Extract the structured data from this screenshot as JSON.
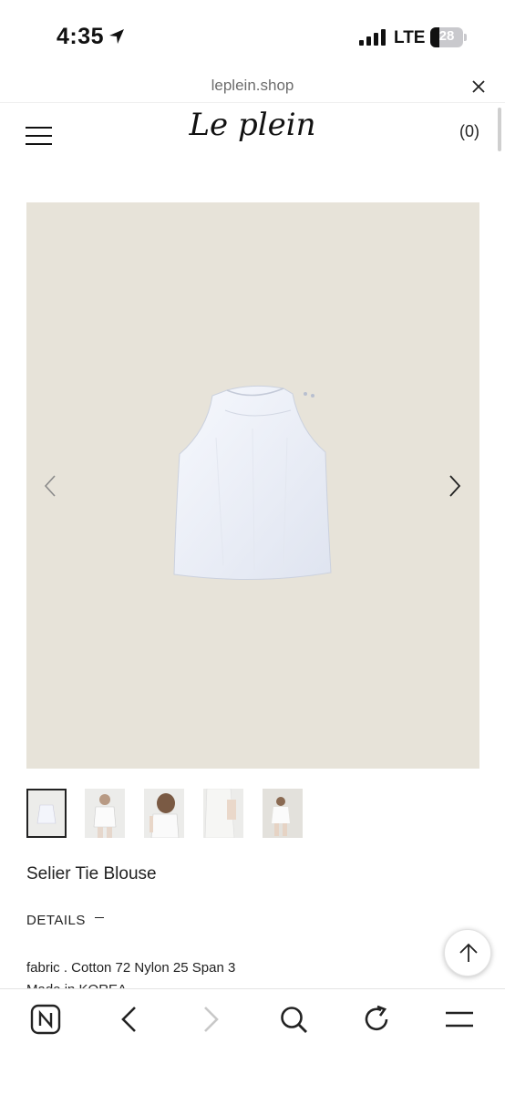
{
  "status_bar": {
    "time": "4:35",
    "carrier": "LTE",
    "battery_level": "28",
    "battery_fraction": 0.28
  },
  "browser": {
    "url": "leplein.shop"
  },
  "site": {
    "logo_text": "Le plein",
    "cart_count": "(0)"
  },
  "product": {
    "title": "Selier Tie Blouse",
    "details_label": "DETAILS",
    "fabric": "fabric . Cotton 72 Nylon 25 Span 3",
    "origin": "Made in KOREA",
    "thumbnail_count": 5,
    "active_thumbnail": 1
  },
  "icons": {
    "status": [
      "location-arrow-icon",
      "signal-icon",
      "battery-icon"
    ],
    "header": [
      "menu-icon",
      "close-icon"
    ],
    "gallery": [
      "chevron-left-icon",
      "chevron-right-icon"
    ],
    "page": [
      "arrow-up-icon"
    ],
    "toolbar": [
      "naver-home-icon",
      "back-icon",
      "forward-icon",
      "search-icon",
      "reload-icon",
      "menu-icon"
    ]
  },
  "colors": {
    "image_background": "#e7e3d9",
    "text": "#222222",
    "disabled": "#c8c8c8"
  }
}
